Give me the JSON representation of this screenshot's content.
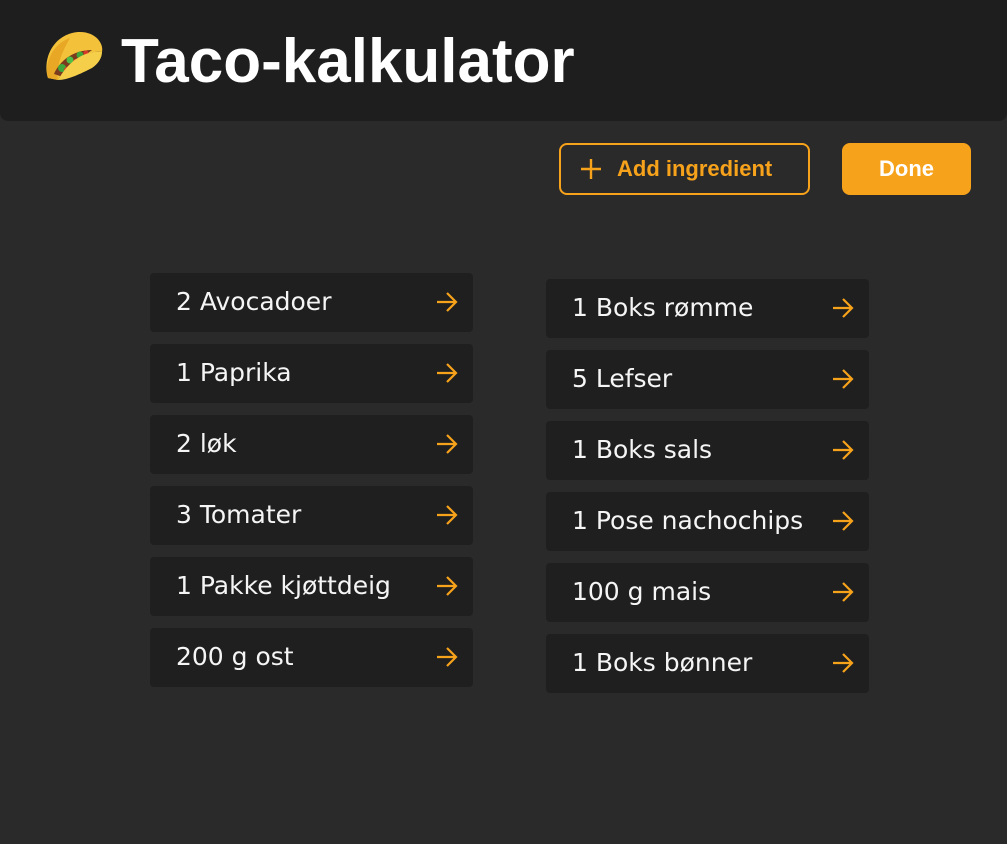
{
  "header": {
    "icon": "taco-icon",
    "title": "Taco-kalkulator"
  },
  "toolbar": {
    "add_label": "Add ingredient",
    "add_icon": "plus-icon",
    "done_label": "Done"
  },
  "colors": {
    "accent": "#f7a21b",
    "background": "#2a2a2a",
    "header": "#1e1e1e",
    "card": "#1f1f1f"
  },
  "ingredients": {
    "left": [
      "2 Avocadoer",
      "1 Paprika",
      "2 løk",
      "3 Tomater",
      "1 Pakke kjøttdeig",
      "200 g ost"
    ],
    "right": [
      "1 Boks rømme",
      "5 Lefser",
      "1 Boks sals",
      "1 Pose nachochips",
      "100 g mais",
      "1 Boks bønner"
    ],
    "item_icon": "arrow-right-icon"
  }
}
